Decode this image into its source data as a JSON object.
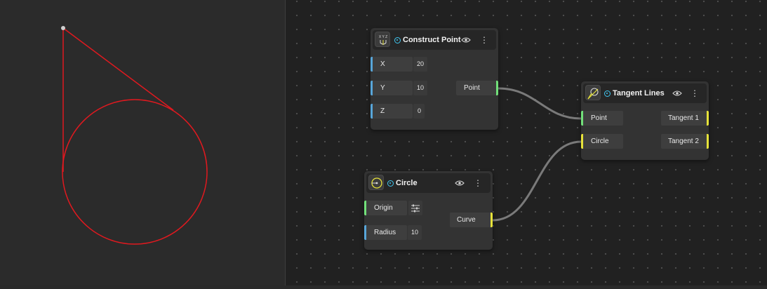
{
  "colors": {
    "geometry": "#e0191f",
    "input_blue": "#58a6d9",
    "point_green": "#72e07a",
    "curve_yellow": "#e6e23a",
    "status": "#3fc6f0",
    "wire": "#7a7a7a"
  },
  "nodes": {
    "construct_point": {
      "title": "Construct Point",
      "icon": "xyz-axes-icon",
      "icon_letters": "X Y Z",
      "inputs": [
        {
          "label": "X",
          "value": "20"
        },
        {
          "label": "Y",
          "value": "10"
        },
        {
          "label": "Z",
          "value": "0"
        }
      ],
      "output": "Point"
    },
    "circle": {
      "title": "Circle",
      "icon": "circle-icon",
      "inputs": [
        {
          "label": "Origin",
          "value": ""
        },
        {
          "label": "Radius",
          "value": "10"
        }
      ],
      "output": "Curve"
    },
    "tangent_lines": {
      "title": "Tangent Lines",
      "icon": "tangent-icon",
      "inputs": [
        {
          "label": "Point"
        },
        {
          "label": "Circle"
        }
      ],
      "outputs": [
        "Tangent 1",
        "Tangent 2"
      ]
    }
  }
}
